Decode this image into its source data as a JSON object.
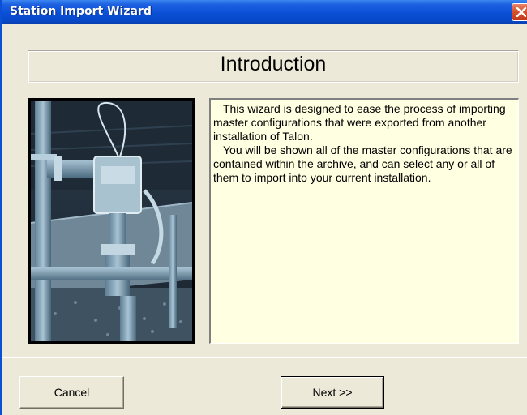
{
  "window": {
    "title": "Station Import Wizard"
  },
  "header": {
    "title": "Introduction"
  },
  "description": {
    "paragraphs": [
      "This wizard is designed to ease the process of importing master configurations that were exported from another installation of Talon.",
      "You will be shown all of the master configurations that are contained within the archive, and can select any or all of them to import into your current installation."
    ]
  },
  "buttons": {
    "cancel_label": "Cancel",
    "next_label": "Next >>"
  },
  "colors": {
    "title_bar": "#0a4fd6",
    "dialog_background": "#ece9d8",
    "description_background": "#ffffe1",
    "close_button": "#d9512c"
  },
  "icons": {
    "close": "close-icon"
  }
}
